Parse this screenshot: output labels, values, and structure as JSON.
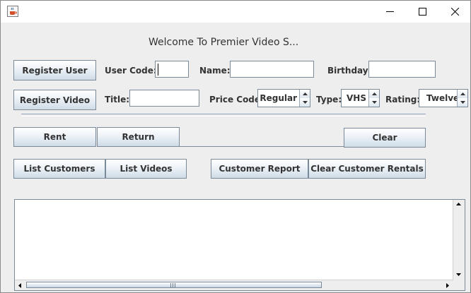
{
  "window": {
    "title": "",
    "icon": "java-cup-icon",
    "controls": [
      "minimize-icon",
      "maximize-icon",
      "close-icon"
    ]
  },
  "header": {
    "welcome": "Welcome To Premier Video S..."
  },
  "row1": {
    "register_user_label": "Register User",
    "user_code_label": "User Code:",
    "user_code_value": "",
    "name_label": "Name:",
    "name_value": "",
    "birthday_label": "Birthday:",
    "birthday_value": ""
  },
  "row2": {
    "register_video_label": "Register Video",
    "title_label": "Title:",
    "title_value": "",
    "price_code_label": "Price Code:",
    "price_code_value": "Regular",
    "type_label": "Type:",
    "type_value": "VHS",
    "rating_label": "Rating:",
    "rating_value": "Twelve"
  },
  "actions": {
    "rent": "Rent",
    "return": "Return",
    "clear": "Clear",
    "list_customers": "List Customers",
    "list_videos": "List Videos",
    "customer_report": "Customer Report",
    "clear_customer_rentals": "Clear Customer Rentals"
  },
  "output": {
    "text": ""
  },
  "colors": {
    "background": "#eeeeee",
    "button_border": "#7a8a99",
    "separator": "#8da2bd"
  }
}
